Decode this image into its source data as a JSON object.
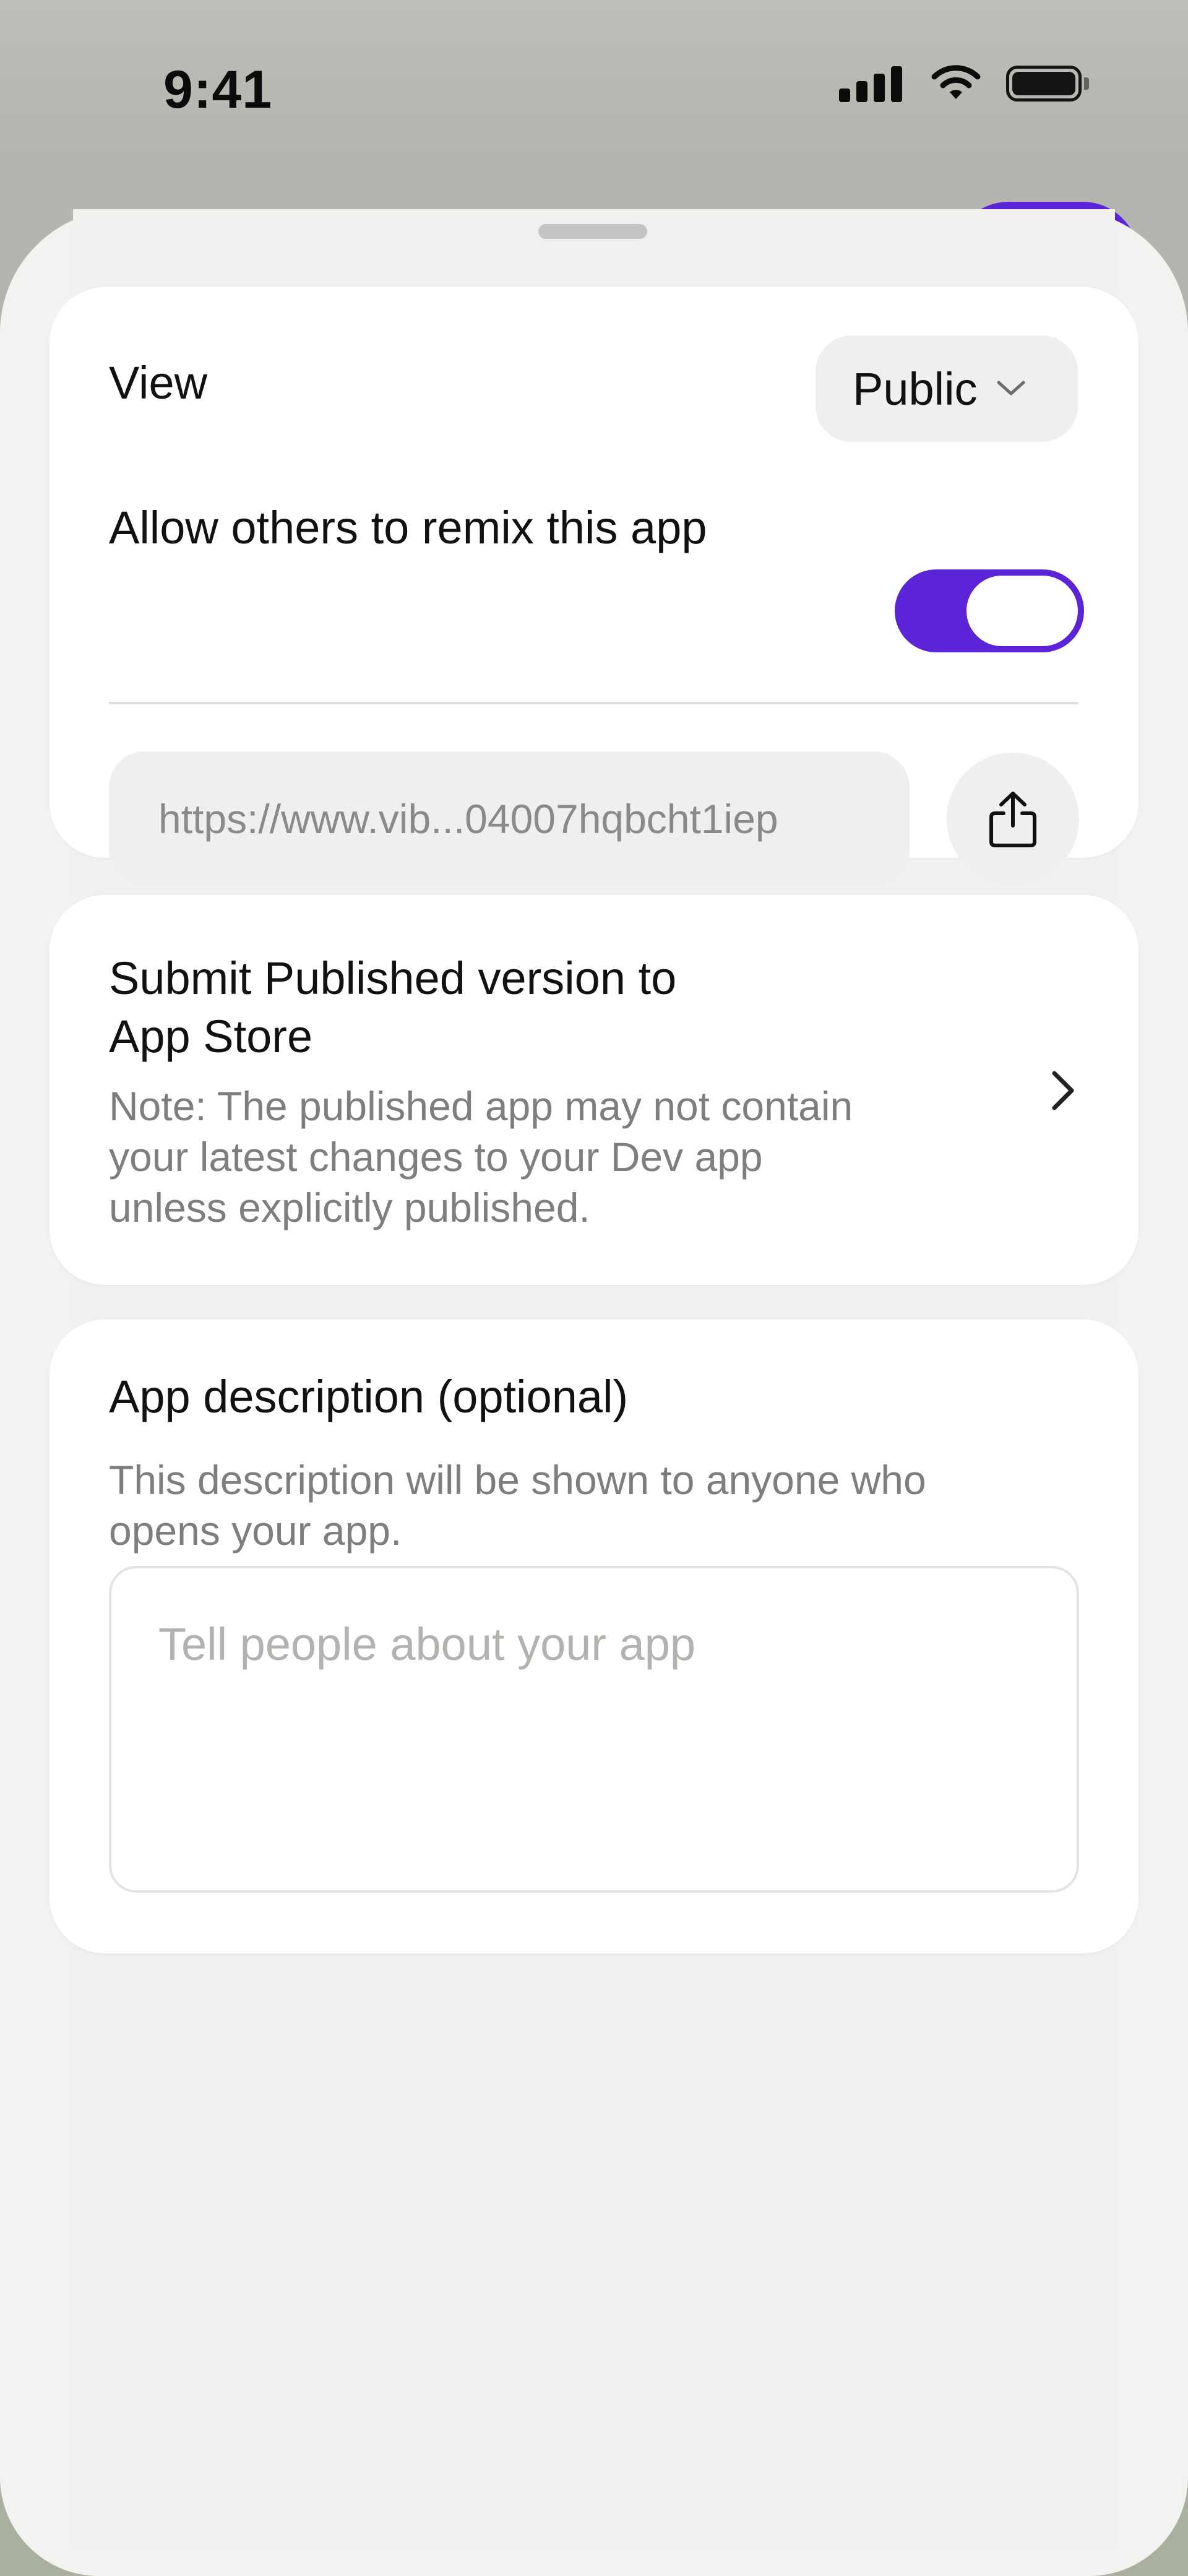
{
  "status_bar": {
    "time": "9:41",
    "icons": [
      "signal-icon",
      "wifi-icon",
      "battery-icon"
    ]
  },
  "sharing": {
    "view_label": "View",
    "view_value": "Public",
    "remix_label": "Allow others to remix this app",
    "remix_enabled": true,
    "url": "https://www.vib...04007hqbcht1iep",
    "share_icon": "share-icon"
  },
  "app_store": {
    "title_line1": "Submit Published version to",
    "title_line2": "App Store",
    "note_line1": "Note: The published app may not contain",
    "note_line2": "your latest changes to your Dev app",
    "note_line3": "unless explicitly published."
  },
  "description": {
    "title": "App description (optional)",
    "help_line1": "This description will be shown to anyone who",
    "help_line2": "opens your app.",
    "placeholder": "Tell people about your app"
  },
  "colors": {
    "accent": "#5b24d8",
    "sheet": "#f2f2f0",
    "card": "#ffffff",
    "muted_text": "#7e7e7c",
    "placeholder": "#b2b2ae"
  }
}
